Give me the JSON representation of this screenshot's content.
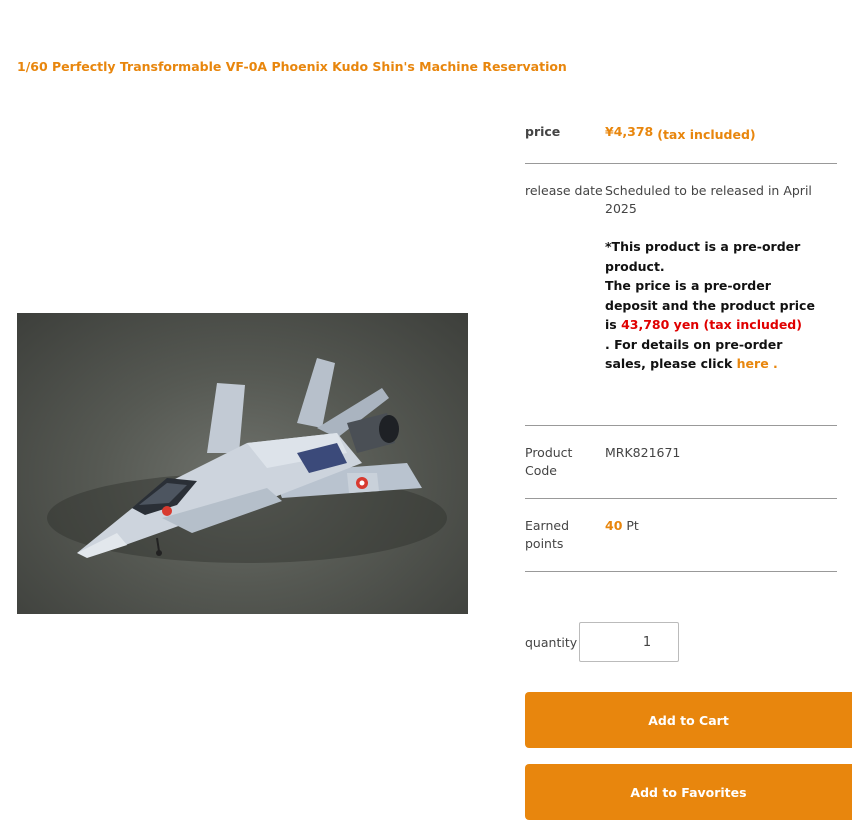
{
  "product": {
    "title": "1/60 Perfectly Transformable VF-0A Phoenix Kudo Shin's Machine Reservation",
    "image_alt": "VF-0A Phoenix model kit"
  },
  "spec": {
    "price_label": "price",
    "price_value": "¥4,378",
    "price_tax": "(tax included)",
    "release_label": "release date",
    "release_value": "Scheduled to be released in April 2025",
    "note_part1": "*This product is a pre-order product.",
    "note_part2": "The price is a pre-order deposit and the product price is",
    "note_price": "43,780 yen (tax included)",
    "note_part3": ". For details on pre-order sales, please click",
    "note_link": "here .",
    "code_label": "Product Code",
    "code_value": "MRK821671",
    "points_label": "Earned points",
    "points_value": "40",
    "points_unit": "Pt"
  },
  "cart": {
    "quantity_label": "quantity",
    "quantity_value": "1",
    "add_to_cart": "Add to Cart",
    "add_to_favorites": "Add to Favorites"
  },
  "colors": {
    "accent": "#e8860d",
    "price_red": "#e00000"
  }
}
